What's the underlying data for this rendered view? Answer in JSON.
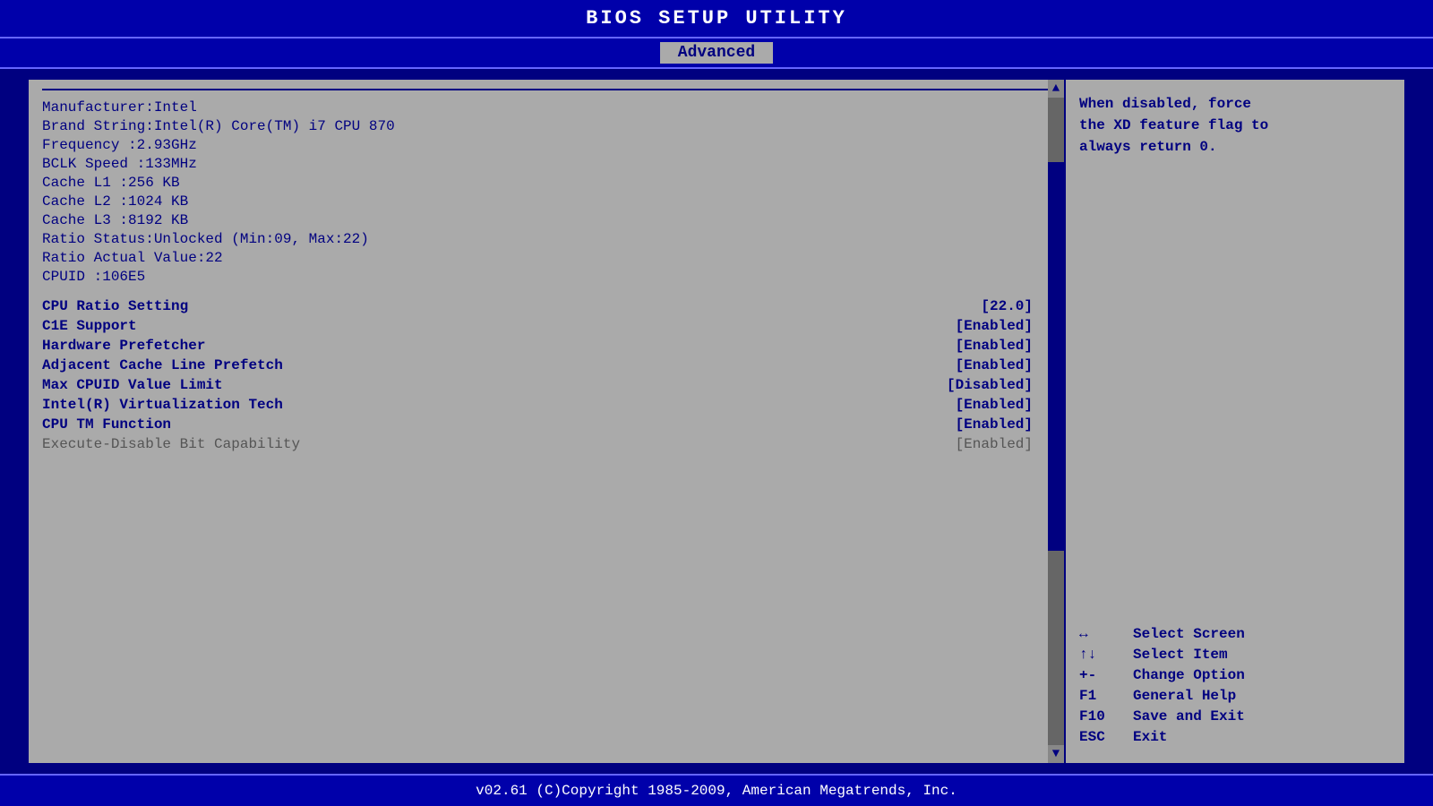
{
  "header": {
    "title": "BIOS  SETUP  UTILITY",
    "active_tab": "Advanced"
  },
  "info": {
    "manufacturer": "Manufacturer:Intel",
    "brand_string": "Brand String:Intel(R)  Core(TM)  i7 CPU        870",
    "frequency": "Frequency    :2.93GHz",
    "bclk_speed": "BCLK Speed   :133MHz",
    "cache_l1": "Cache L1     :256  KB",
    "cache_l2": "Cache L2     :1024  KB",
    "cache_l3": "Cache L3     :8192  KB",
    "ratio_status": "Ratio Status:Unlocked  (Min:09,  Max:22)",
    "ratio_actual": "Ratio Actual Value:22",
    "cpuid": "CPUID        :106E5"
  },
  "settings": [
    {
      "label": "CPU Ratio Setting",
      "value": "[22.0]",
      "bold": true
    },
    {
      "label": "C1E Support",
      "value": "[Enabled]",
      "bold": true
    },
    {
      "label": "Hardware Prefetcher",
      "value": "[Enabled]",
      "bold": true
    },
    {
      "label": "Adjacent Cache Line Prefetch",
      "value": "[Enabled]",
      "bold": true
    },
    {
      "label": "Max CPUID Value Limit",
      "value": "[Disabled]",
      "bold": true
    },
    {
      "label": "Intel(R) Virtualization Tech",
      "value": "[Enabled]",
      "bold": true
    },
    {
      "label": "CPU TM Function",
      "value": "[Enabled]",
      "bold": true
    },
    {
      "label": "Execute-Disable Bit Capability",
      "value": "[Enabled]",
      "bold": false
    }
  ],
  "help_text": "When disabled, force\nthe XD feature flag to\nalways return 0.",
  "key_help": [
    {
      "symbol": "↔",
      "desc": "Select Screen"
    },
    {
      "symbol": "↑↓",
      "desc": "Select Item"
    },
    {
      "symbol": "+-",
      "desc": "Change Option"
    },
    {
      "symbol": "F1",
      "desc": "General Help"
    },
    {
      "symbol": "F10",
      "desc": "Save and Exit"
    },
    {
      "symbol": "ESC",
      "desc": "Exit"
    }
  ],
  "footer": "v02.61  (C)Copyright 1985-2009, American Megatrends, Inc."
}
